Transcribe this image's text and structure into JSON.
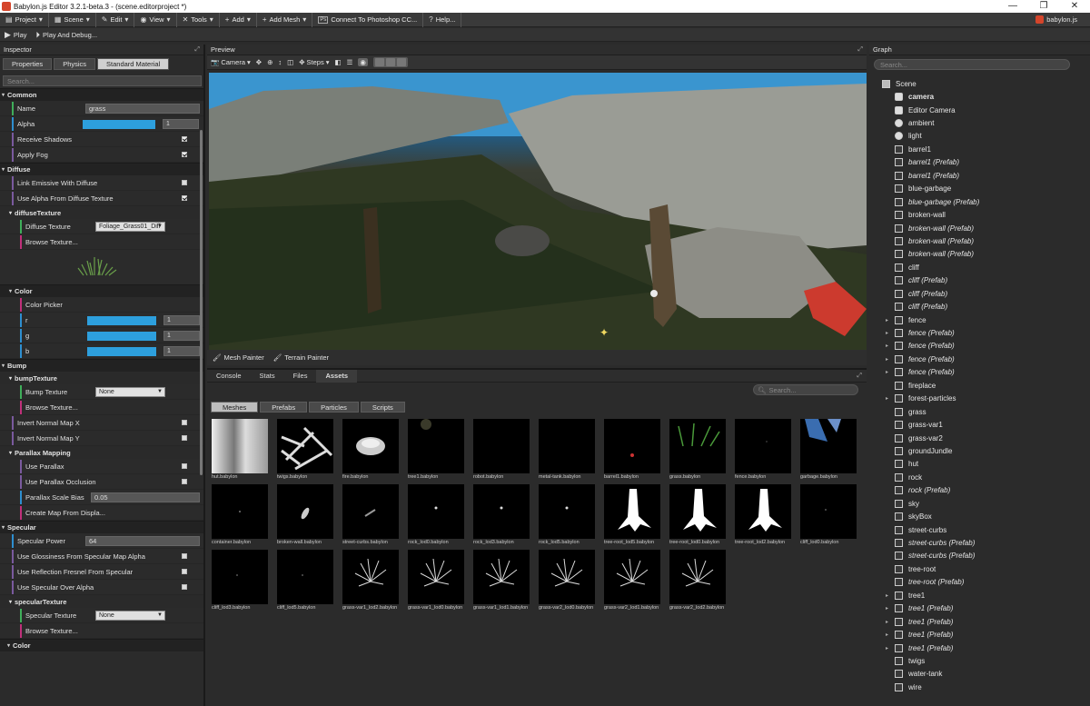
{
  "window": {
    "title": "Babylon.js Editor 3.2.1-beta.3 - (scene.editorproject *)"
  },
  "menu": {
    "items": [
      {
        "icon": "▤",
        "label": "Project"
      },
      {
        "icon": "▦",
        "label": "Scene"
      },
      {
        "icon": "✎",
        "label": "Edit"
      },
      {
        "icon": "◉",
        "label": "View"
      },
      {
        "icon": "✕",
        "label": "Tools"
      },
      {
        "icon": "+",
        "label": "Add"
      },
      {
        "icon": "+",
        "label": "Add Mesh"
      },
      {
        "icon": "Ps",
        "label": "Connect To Photoshop CC..."
      },
      {
        "icon": "?",
        "label": "Help..."
      }
    ],
    "brand": "babylon.js"
  },
  "toolbar": {
    "play": "Play",
    "play_debug": "Play And Debug..."
  },
  "inspector": {
    "title": "Inspector",
    "tabs": [
      "Properties",
      "Physics",
      "Standard Material"
    ],
    "active_tab": 2,
    "search_placeholder": "Search...",
    "common": {
      "title": "Common",
      "name_label": "Name",
      "name_value": "grass",
      "alpha_label": "Alpha",
      "alpha_value": "1",
      "receive_shadows": "Receive Shadows",
      "apply_fog": "Apply Fog"
    },
    "diffuse": {
      "title": "Diffuse",
      "link_emissive": "Link Emissive With Diffuse",
      "use_alpha": "Use Alpha From Diffuse Texture",
      "tex_section": "diffuseTexture",
      "tex_label": "Diffuse Texture",
      "tex_value": "Foliage_Grass01_Diff",
      "browse": "Browse Texture..."
    },
    "color": {
      "title": "Color",
      "picker": "Color Picker",
      "r": "r",
      "g": "g",
      "b": "b",
      "r_val": "1",
      "g_val": "1",
      "b_val": "1"
    },
    "bump": {
      "title": "Bump",
      "tex_section": "bumpTexture",
      "tex_label": "Bump Texture",
      "tex_value": "None",
      "browse": "Browse Texture...",
      "invert_x": "Invert Normal Map X",
      "invert_y": "Invert Normal Map Y"
    },
    "parallax": {
      "title": "Parallax Mapping",
      "use": "Use Parallax",
      "occlusion": "Use Parallax Occlusion",
      "bias_label": "Parallax Scale Bias",
      "bias_value": "0.05",
      "create": "Create Map From Displa..."
    },
    "specular": {
      "title": "Specular",
      "power_label": "Specular Power",
      "power_value": "64",
      "gloss": "Use Glossiness From Specular Map Alpha",
      "fresnel": "Use Reflection Fresnel From Specular",
      "over_alpha": "Use Specular Over Alpha",
      "tex_section": "specularTexture",
      "tex_label": "Specular Texture",
      "tex_value": "None",
      "browse": "Browse Texture...",
      "color": "Color"
    }
  },
  "preview": {
    "title": "Preview",
    "camera": "Camera",
    "steps": "Steps",
    "mesh_painter": "Mesh Painter",
    "terrain_painter": "Terrain Painter"
  },
  "assets": {
    "tabs": [
      "Console",
      "Stats",
      "Files",
      "Assets"
    ],
    "active_tab": 3,
    "search_placeholder": "Search...",
    "types": [
      "Meshes",
      "Prefabs",
      "Particles",
      "Scripts"
    ],
    "active_type": 0,
    "items": [
      "hut.babylon",
      "twigs.babylon",
      "fire.babylon",
      "tree1.babylon",
      "robot.babylon",
      "metal-tank.babylon",
      "barrel1.babylon",
      "grass.babylon",
      "fence.babylon",
      "garbage.babylon",
      "container.babylon",
      "broken-wall.babylon",
      "street-curbs.babylon",
      "rock_lod0.babylon",
      "rock_lod3.babylon",
      "rock_lod5.babylon",
      "tree-root_lod5.babylon",
      "tree-root_lod0.babylon",
      "tree-root_lod2.babylon",
      "cliff_lod0.babylon",
      "cliff_lod3.babylon",
      "cliff_lod5.babylon",
      "grass-var1_lod2.babylon",
      "grass-var1_lod0.babylon",
      "grass-var1_lod1.babylon",
      "grass-var2_lod0.babylon",
      "grass-var2_lod1.babylon",
      "grass-var2_lod2.babylon"
    ]
  },
  "graph": {
    "title": "Graph",
    "search_placeholder": "Search...",
    "nodes": [
      {
        "label": "Scene",
        "type": "root",
        "exp": "",
        "prefab": false
      },
      {
        "label": "camera",
        "type": "cam",
        "exp": "",
        "prefab": false,
        "bold": true
      },
      {
        "label": "Editor Camera",
        "type": "cam",
        "exp": "",
        "prefab": false
      },
      {
        "label": "ambient",
        "type": "light",
        "exp": "",
        "prefab": false
      },
      {
        "label": "light",
        "type": "light",
        "exp": "",
        "prefab": false
      },
      {
        "label": "barrel1",
        "type": "mesh",
        "exp": "",
        "prefab": false
      },
      {
        "label": "barrel1 (Prefab)",
        "type": "mesh",
        "exp": "",
        "prefab": true
      },
      {
        "label": "barrel1 (Prefab)",
        "type": "mesh",
        "exp": "",
        "prefab": true
      },
      {
        "label": "blue-garbage",
        "type": "mesh",
        "exp": "",
        "prefab": false
      },
      {
        "label": "blue-garbage (Prefab)",
        "type": "mesh",
        "exp": "",
        "prefab": true
      },
      {
        "label": "broken-wall",
        "type": "mesh",
        "exp": "",
        "prefab": false
      },
      {
        "label": "broken-wall (Prefab)",
        "type": "mesh",
        "exp": "",
        "prefab": true
      },
      {
        "label": "broken-wall (Prefab)",
        "type": "mesh",
        "exp": "",
        "prefab": true
      },
      {
        "label": "broken-wall (Prefab)",
        "type": "mesh",
        "exp": "",
        "prefab": true
      },
      {
        "label": "cliff",
        "type": "mesh",
        "exp": "",
        "prefab": false
      },
      {
        "label": "cliff (Prefab)",
        "type": "mesh",
        "exp": "",
        "prefab": true
      },
      {
        "label": "cliff (Prefab)",
        "type": "mesh",
        "exp": "",
        "prefab": true
      },
      {
        "label": "cliff (Prefab)",
        "type": "mesh",
        "exp": "",
        "prefab": true
      },
      {
        "label": "fence",
        "type": "mesh",
        "exp": "▸",
        "prefab": false
      },
      {
        "label": "fence (Prefab)",
        "type": "mesh",
        "exp": "▸",
        "prefab": true
      },
      {
        "label": "fence (Prefab)",
        "type": "mesh",
        "exp": "▸",
        "prefab": true
      },
      {
        "label": "fence (Prefab)",
        "type": "mesh",
        "exp": "▸",
        "prefab": true
      },
      {
        "label": "fence (Prefab)",
        "type": "mesh",
        "exp": "▸",
        "prefab": true
      },
      {
        "label": "fireplace",
        "type": "mesh",
        "exp": "",
        "prefab": false
      },
      {
        "label": "forest-particles",
        "type": "mesh",
        "exp": "▸",
        "prefab": false
      },
      {
        "label": "grass",
        "type": "mesh",
        "exp": "",
        "prefab": false
      },
      {
        "label": "grass-var1",
        "type": "mesh",
        "exp": "",
        "prefab": false
      },
      {
        "label": "grass-var2",
        "type": "mesh",
        "exp": "",
        "prefab": false
      },
      {
        "label": "groundJundle",
        "type": "mesh",
        "exp": "",
        "prefab": false
      },
      {
        "label": "hut",
        "type": "mesh",
        "exp": "",
        "prefab": false
      },
      {
        "label": "rock",
        "type": "mesh",
        "exp": "",
        "prefab": false
      },
      {
        "label": "rock (Prefab)",
        "type": "mesh",
        "exp": "",
        "prefab": true
      },
      {
        "label": "sky",
        "type": "mesh",
        "exp": "",
        "prefab": false
      },
      {
        "label": "skyBox",
        "type": "mesh",
        "exp": "",
        "prefab": false
      },
      {
        "label": "street-curbs",
        "type": "mesh",
        "exp": "",
        "prefab": false
      },
      {
        "label": "street-curbs (Prefab)",
        "type": "mesh",
        "exp": "",
        "prefab": true
      },
      {
        "label": "street-curbs (Prefab)",
        "type": "mesh",
        "exp": "",
        "prefab": true
      },
      {
        "label": "tree-root",
        "type": "mesh",
        "exp": "",
        "prefab": false
      },
      {
        "label": "tree-root (Prefab)",
        "type": "mesh",
        "exp": "",
        "prefab": true
      },
      {
        "label": "tree1",
        "type": "mesh",
        "exp": "▸",
        "prefab": false
      },
      {
        "label": "tree1 (Prefab)",
        "type": "mesh",
        "exp": "▸",
        "prefab": true
      },
      {
        "label": "tree1 (Prefab)",
        "type": "mesh",
        "exp": "▸",
        "prefab": true
      },
      {
        "label": "tree1 (Prefab)",
        "type": "mesh",
        "exp": "▸",
        "prefab": true
      },
      {
        "label": "tree1 (Prefab)",
        "type": "mesh",
        "exp": "▸",
        "prefab": true
      },
      {
        "label": "twigs",
        "type": "mesh",
        "exp": "",
        "prefab": false
      },
      {
        "label": "water-tank",
        "type": "mesh",
        "exp": "",
        "prefab": false
      },
      {
        "label": "wire",
        "type": "mesh",
        "exp": "",
        "prefab": false
      }
    ]
  },
  "colors": {
    "accent_blue": "#2d9fdd",
    "bar_green": "#3fae5a",
    "bar_purple": "#7a5a9e",
    "bar_blue": "#2e8fd0",
    "bar_pink": "#c0307a"
  }
}
